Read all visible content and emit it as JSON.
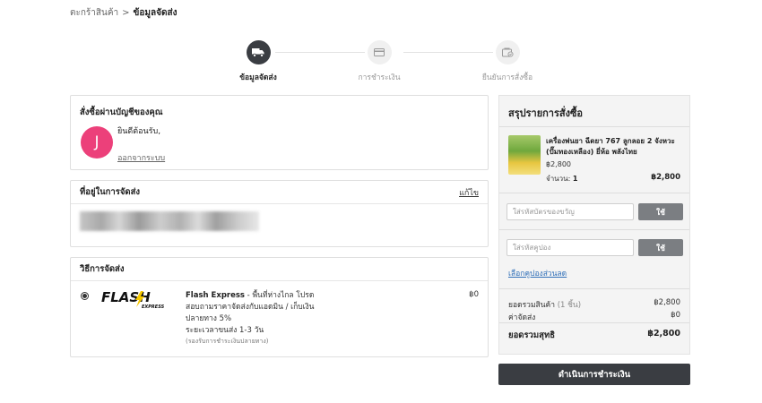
{
  "breadcrumb": {
    "parent": "ตะกร้าสินค้า",
    "separator": ">",
    "current": "ข้อมูลจัดส่ง"
  },
  "steps": [
    {
      "label": "ข้อมูลจัดส่ง",
      "icon": "truck-icon",
      "state": "active"
    },
    {
      "label": "การชำระเงิน",
      "icon": "credit-card-icon",
      "state": "inactive"
    },
    {
      "label": "ยืนยันการสั่งซื้อ",
      "icon": "checkout-icon",
      "state": "inactive"
    }
  ],
  "account": {
    "title": "สั่งซื้อผ่านบัญชีของคุณ",
    "avatar_letter": "J",
    "welcome": "ยินดีต้อนรับ,",
    "logout": "ออกจากระบบ"
  },
  "address": {
    "title": "ที่อยู่ในการจัดส่ง",
    "edit": "แก้ไข"
  },
  "shipping": {
    "title": "วิธีการจัดส่ง",
    "provider_name": "Flash Express",
    "provider_desc": " - พื้นที่ห่างไกล โปรด",
    "logo_text": "FLASH",
    "logo_sub": "EXPRESS",
    "lines": [
      "สอบถามราคาจัดส่งกับแอดมิน / เก็บเงิน",
      "ปลายทาง 5%",
      "ระยะเวลาขนส่ง 1-3 วัน"
    ],
    "note": "(รองรับการชำระเงินปลายทาง)",
    "price": "฿0"
  },
  "summary": {
    "title": "สรุปรายการสั่งซื้อ",
    "product": {
      "name": "เครื่องพ่นยา ฉีดยา 767 ลูกลอย 2 จังหวะ (ปั๊มทองเหลือง) ยี่ห้อ พลังไทย",
      "price": "฿2,800",
      "qty_label": "จำนวน:",
      "qty": "1",
      "total": "฿2,800"
    },
    "gift_placeholder": "ใส่รหัสบัตรของขวัญ",
    "gift_button": "ใช้",
    "coupon_placeholder": "ใส่รหัสคูปอง",
    "coupon_button": "ใช้",
    "coupon_link": "เลือกคูปองส่วนลด",
    "subtotal_label": "ยอดรวมสินค้า",
    "subtotal_count": "(1 ชิ้น)",
    "subtotal": "฿2,800",
    "shipping_label": "ค่าจัดส่ง",
    "shipping": "฿0",
    "total_label": "ยอดรวมสุทธิ",
    "total": "฿2,800"
  },
  "pay_button": "ดำเนินการชำระเงิน",
  "colors": {
    "dark": "#3a3d42",
    "avatar": "#ec407a",
    "link": "#2f6fb8",
    "button_gray": "#7b7e82"
  }
}
